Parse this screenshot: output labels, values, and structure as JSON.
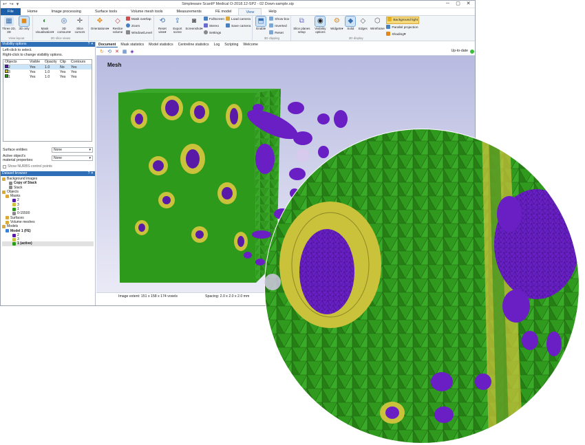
{
  "window": {
    "title": "Simpleware ScanIP Medical O-2018.12-SP2 - 02 Down-sample.sip",
    "quick_access": [
      "↩",
      "↪",
      "▾"
    ],
    "controls": [
      "─",
      "▢",
      "✕"
    ]
  },
  "menu_tabs": [
    "File",
    "Home",
    "Image processing",
    "Surface tools",
    "Volume mesh tools",
    "Measurements",
    "FE model",
    "View",
    "Help"
  ],
  "ribbon": {
    "view_layout": {
      "label": "View layout",
      "buttons": [
        "Three 2D, 3D",
        "3D only"
      ]
    },
    "slice_views": {
      "label": "2D slice views",
      "buttons": [
        "Mask visualisation▾",
        "3D contours▾",
        "Slice cursors"
      ]
    },
    "view_3d": {
      "label": "3D view",
      "buttons": [
        "Orientations▾",
        "Reslice volume"
      ],
      "small": [
        "Mask overlap",
        "Zoom",
        "Window/Level"
      ]
    },
    "scene": {
      "buttons": [
        "Reset view▾",
        "Export scene",
        "Screenshot▾"
      ],
      "small": [
        "Fullscreen",
        "Stereo",
        "Settings"
      ],
      "small2": [
        "Load camera",
        "Save camera"
      ]
    },
    "clipping": {
      "label": "3D clipping",
      "buttons": [
        "Enable"
      ],
      "small": [
        "Show box",
        "Inverted",
        "Reset"
      ]
    },
    "display": {
      "label": "3D display",
      "buttons": [
        "Slice planes setup",
        "Visibility options",
        "Widgets▾",
        "Solid",
        "Edges",
        "Wireframe"
      ],
      "small": [
        "Background light",
        "Parallel projection",
        "Shading▾"
      ]
    }
  },
  "visibility_panel": {
    "title": "Visibility options",
    "hint_1": "Left-click to select.",
    "hint_2": "Right-click to change visibility options.",
    "headers": [
      "Objects",
      "Visible",
      "Opacity",
      "Clip",
      "Contours"
    ],
    "rows": [
      {
        "name": "2",
        "visible": "Yes",
        "opacity": "1.0",
        "clip": "No",
        "contours": "Yes",
        "color": "#5a1aa8"
      },
      {
        "name": "3",
        "visible": "Yes",
        "opacity": "1.0",
        "clip": "Yes",
        "contours": "Yes",
        "color": "#c9c23a"
      },
      {
        "name": "1",
        "visible": "Yes",
        "opacity": "1.0",
        "clip": "Yes",
        "contours": "Yes",
        "color": "#2e9a1c"
      }
    ],
    "surface_entities_label": "Surface entities",
    "surface_entities_value": "None",
    "active_material_label_1": "Active object's",
    "active_material_label_2": "material properties:",
    "active_material_value": "None",
    "nurbs_label": "Show NURBS control points"
  },
  "dataset_browser": {
    "title": "Dataset browser",
    "items": [
      {
        "label": "Background images",
        "indent": 0,
        "color": "#d9a93a"
      },
      {
        "label": "Copy of Stack",
        "indent": 2,
        "color": "#8a8a8a",
        "bold": true
      },
      {
        "label": "Stack",
        "indent": 2,
        "color": "#8a8a8a"
      },
      {
        "label": "Objects",
        "indent": 0,
        "color": "#d9a93a"
      },
      {
        "label": "Masks",
        "indent": 1,
        "color": "#d9a93a"
      },
      {
        "label": "2",
        "indent": 3,
        "color": "#5a1aa8"
      },
      {
        "label": "3",
        "indent": 3,
        "color": "#c9c23a"
      },
      {
        "label": "1",
        "indent": 3,
        "color": "#2e9a1c"
      },
      {
        "label": "0-15500",
        "indent": 3,
        "color": "#888888"
      },
      {
        "label": "Surfaces",
        "indent": 1,
        "color": "#d9a93a"
      },
      {
        "label": "Volume meshes",
        "indent": 1,
        "color": "#d9a93a"
      },
      {
        "label": "Models",
        "indent": 0,
        "color": "#d9a93a"
      },
      {
        "label": "Model 1 (FE)",
        "indent": 1,
        "color": "#3a7fd6",
        "bold": true
      },
      {
        "label": "2",
        "indent": 3,
        "color": "#5a1aa8"
      },
      {
        "label": "3",
        "indent": 3,
        "color": "#c9c23a"
      },
      {
        "label": "1 (active)",
        "indent": 3,
        "color": "#2e9a1c",
        "bold": true,
        "selected": true
      }
    ]
  },
  "doc_tabs": [
    "Document",
    "Mask statistics",
    "Model statistics",
    "Centreline statistics",
    "Log",
    "Scripting",
    "Welcome"
  ],
  "viewer": {
    "label": "Mesh",
    "status": "Up-to-date",
    "toolbar": [
      "↻",
      "⟲",
      "✕",
      "▦",
      "◈"
    ]
  },
  "statusbar": {
    "extent": "Image extent: 151 x 158 x 174 voxels",
    "spacing": "Spacing: 2.0 x 2.0 x 2.0 mm"
  },
  "colors": {
    "accent": "#1c5fa8",
    "mesh_green": "#2e9a1c",
    "mesh_purple": "#5a1aa8",
    "mesh_yellow": "#c9c23a"
  }
}
